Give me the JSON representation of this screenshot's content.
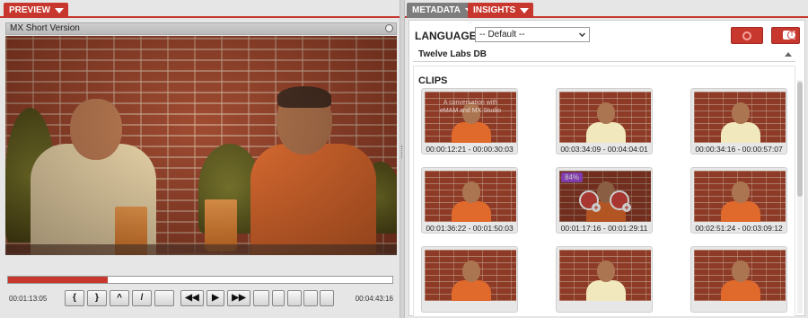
{
  "preview": {
    "tab_label": "PREVIEW",
    "video_title": "MX Short Version",
    "current_time": "00:01:13:05",
    "total_time": "00:04:43:16",
    "progress": 0.26,
    "controls": [
      {
        "label": "{",
        "icon": "mark-in-icon"
      },
      {
        "label": "}",
        "icon": "mark-out-icon"
      },
      {
        "label": "^",
        "icon": "up-icon"
      },
      {
        "label": "/",
        "icon": "pen-icon"
      },
      {
        "label": "",
        "icon": "screens-icon"
      },
      {
        "label": "◀◀",
        "icon": "rewind-icon"
      },
      {
        "label": "▶",
        "icon": "play-icon"
      },
      {
        "label": "▶▶",
        "icon": "fast-forward-icon"
      },
      {
        "label": "",
        "icon": "caption-icon"
      },
      {
        "label": "",
        "icon": "volume-icon"
      },
      {
        "label": "",
        "icon": "snapshot-icon"
      },
      {
        "label": "",
        "icon": "settings-icon"
      },
      {
        "label": "",
        "icon": "fullscreen-icon"
      }
    ]
  },
  "insights": {
    "tabs": [
      {
        "label": "METADATA",
        "active": false
      },
      {
        "label": "INSIGHTS",
        "active": true
      }
    ],
    "language_label": "LANGUAGE",
    "language_value": "-- Default --",
    "db_title": "Twelve Labs DB",
    "clips_title": "CLIPS",
    "clips": [
      {
        "time": "00:00:12:21 - 00:00:30:03",
        "overlay": "A conversation with eMAM and MX Studio",
        "shirt": "#e0692c"
      },
      {
        "time": "00:03:34:09 - 00:04:04:01",
        "overlay": "",
        "shirt": "#f1e8bd"
      },
      {
        "time": "00:00:34:16 - 00:00:57:07",
        "overlay": "",
        "shirt": "#f1e8bd"
      },
      {
        "time": "00:01:36:22 - 00:01:50:03",
        "overlay": "",
        "shirt": "#e0692c"
      },
      {
        "time": "00:01:17:16 - 00:01:29:11",
        "overlay": "",
        "shirt": "#e0692c",
        "badge": "84%"
      },
      {
        "time": "00:02:51:24 - 00:03:09:12",
        "overlay": "",
        "shirt": "#e0692c"
      },
      {
        "time": "",
        "overlay": "",
        "shirt": "#e0692c"
      },
      {
        "time": "",
        "overlay": "",
        "shirt": "#f1e8bd"
      },
      {
        "time": "",
        "overlay": "",
        "shirt": "#e0692c"
      }
    ]
  },
  "colors": {
    "accent": "#c8372d",
    "badge": "#a04bd7"
  }
}
